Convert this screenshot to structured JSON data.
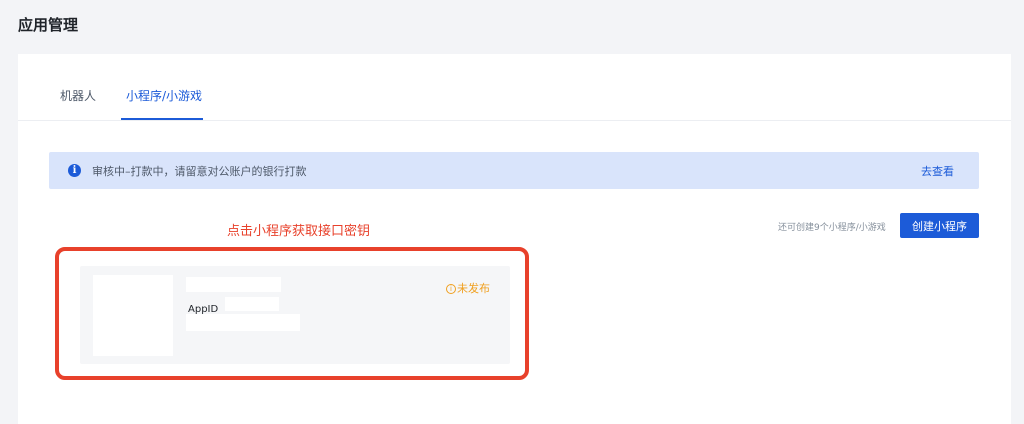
{
  "page": {
    "title": "应用管理"
  },
  "tabs": [
    {
      "label": "机器人",
      "active": false
    },
    {
      "label": "小程序/小游戏",
      "active": true
    }
  ],
  "notice": {
    "icon": "info-icon",
    "text": "审核中–打款中，请留意对公账户的银行打款",
    "link_label": "去查看"
  },
  "annotation": {
    "text": "点击小程序获取接口密钥"
  },
  "toolbar": {
    "quota_text": "还可创建9个小程序/小游戏",
    "create_label": "创建小程序"
  },
  "app_card": {
    "appid_label": "AppID",
    "status_label": "未发布",
    "status_icon": "info-circle-icon"
  },
  "colors": {
    "accent": "#1c5bd8",
    "annotation": "#e8412b",
    "status_warning": "#f0a020",
    "notice_bg": "#d9e4fb"
  }
}
